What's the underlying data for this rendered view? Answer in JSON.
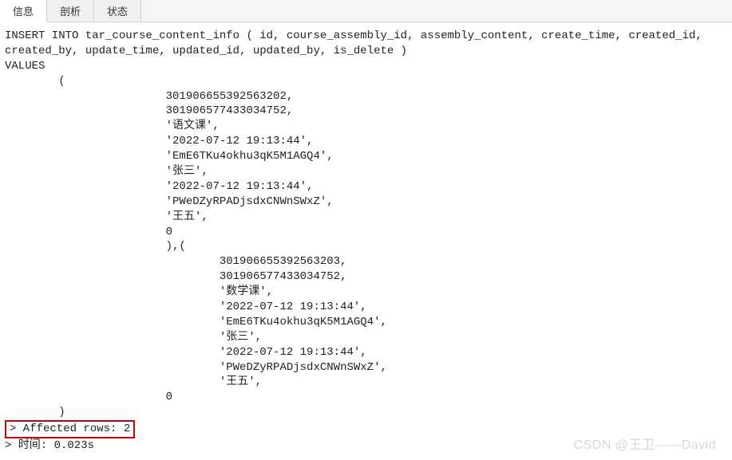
{
  "tabs": {
    "info": "信息",
    "profile": "剖析",
    "status": "状态"
  },
  "sql": {
    "line1": "INSERT INTO tar_course_content_info ( id, course_assembly_id, assembly_content, create_time, created_id,",
    "line2": "created_by, update_time, updated_id, updated_by, is_delete )",
    "line3": "VALUES",
    "line4": "        (",
    "line5": "                        301906655392563202,",
    "line6": "                        301906577433034752,",
    "line7": "                        '语文课',",
    "line8": "                        '2022-07-12 19:13:44',",
    "line9": "                        'EmE6TKu4okhu3qK5M1AGQ4',",
    "line10": "                        '张三',",
    "line11": "                        '2022-07-12 19:13:44',",
    "line12": "                        'PWeDZyRPADjsdxCNWnSWxZ',",
    "line13": "                        '王五',",
    "line14": "                        0",
    "line15": "                        ),(",
    "line16": "                                301906655392563203,",
    "line17": "                                301906577433034752,",
    "line18": "                                '数学课',",
    "line19": "                                '2022-07-12 19:13:44',",
    "line20": "                                'EmE6TKu4okhu3qK5M1AGQ4',",
    "line21": "                                '张三',",
    "line22": "                                '2022-07-12 19:13:44',",
    "line23": "                                'PWeDZyRPADjsdxCNWnSWxZ',",
    "line24": "                                '王五',",
    "line25": "                        0",
    "line26": "        )",
    "affected": "> Affected rows: 2",
    "time": "> 时间: 0.023s"
  },
  "watermark": "CSDN @王卫——David"
}
